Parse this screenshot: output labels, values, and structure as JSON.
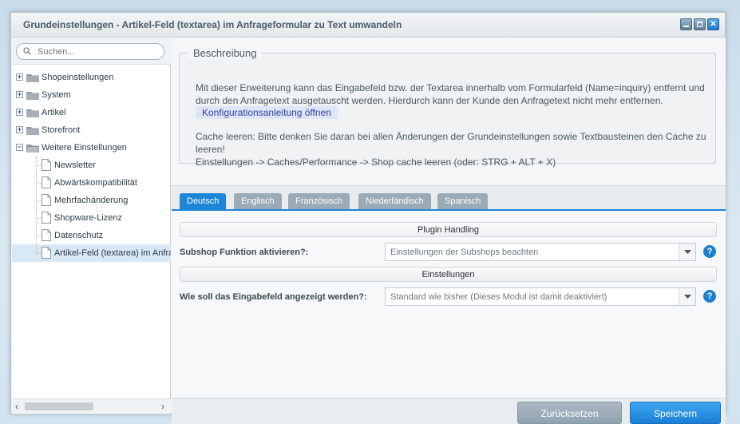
{
  "window": {
    "title": "Grundeinstellungen - Artikel-Feld (textarea) im Anfrageformular zu Text umwandeln"
  },
  "sidebar": {
    "search_placeholder": "Suchen...",
    "folders": [
      {
        "label": "Shopeinstellungen",
        "expanded": false
      },
      {
        "label": "System",
        "expanded": false
      },
      {
        "label": "Artikel",
        "expanded": false
      },
      {
        "label": "Storefront",
        "expanded": false
      },
      {
        "label": "Weitere Einstellungen",
        "expanded": true
      }
    ],
    "children": [
      {
        "label": "Newsletter"
      },
      {
        "label": "Abwärtskompatibilität"
      },
      {
        "label": "Mehrfachänderung"
      },
      {
        "label": "Shopware-Lizenz"
      },
      {
        "label": "Datenschutz"
      },
      {
        "label": "Artikel-Feld (textarea) im Anfrageformular zu Text umwandeln",
        "selected": true
      }
    ]
  },
  "description": {
    "legend": "Beschreibung",
    "text": "Mit dieser Erweiterung kann das Eingabefeld bzw. der Textarea innerhalb vom Formularfeld (Name=inquiry) entfernt und durch den Anfragetext ausgetauscht werden. Hierdurch kann der Kunde den Anfragetext nicht mehr entfernen.",
    "link_label": "Konfigurationsanleitung öffnen",
    "cache_line1": "Cache leeren: Bitte denken Sie daran bei allen Änderungen der Grundeinstellungen sowie Textbausteinen den Cache zu leeren!",
    "cache_line2": "Einstellungen -> Caches/Performance -> Shop cache leeren (oder: STRG + ALT + X)"
  },
  "tabs": [
    {
      "label": "Deutsch",
      "active": true
    },
    {
      "label": "Englisch"
    },
    {
      "label": "Französisch"
    },
    {
      "label": "Niederländisch"
    },
    {
      "label": "Spanisch"
    }
  ],
  "form": {
    "section1": "Plugin Handling",
    "field1_label": "Subshop Funktion aktivieren?:",
    "field1_value": "Einstellungen der Subshops beachten",
    "section2": "Einstellungen",
    "field2_label": "Wie soll das Eingabefeld angezeigt werden?:",
    "field2_value": "Standard wie bisher (Dieses Modul ist damit deaktiviert)",
    "help_glyph": "?"
  },
  "footer": {
    "reset_label": "Zurücksetzen",
    "save_label": "Speichern"
  },
  "colors": {
    "accent": "#1d86d8",
    "tab_inactive": "#9aabb7",
    "reset_button": "#9aaebb",
    "save_button": "#2a91e2"
  }
}
